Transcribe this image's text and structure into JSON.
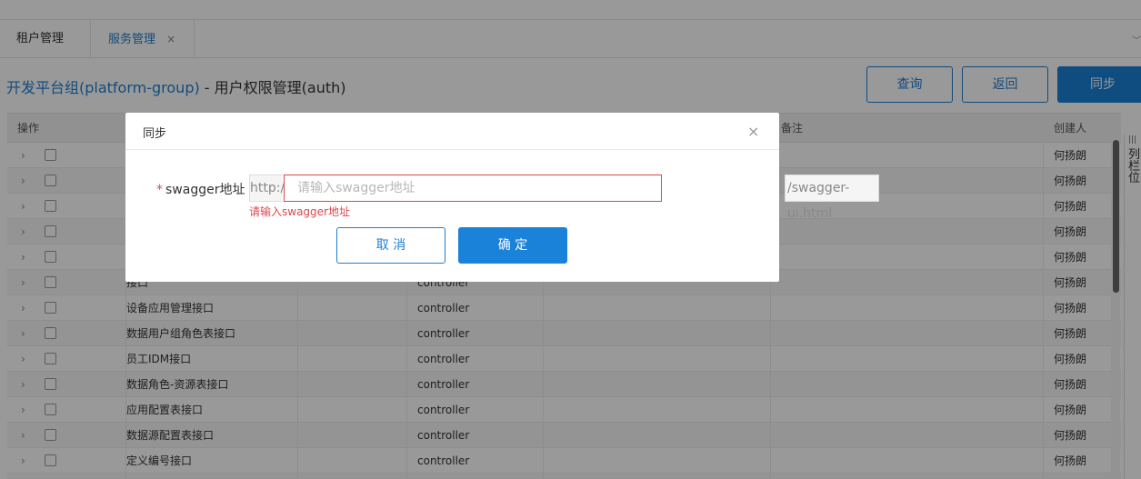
{
  "tabs": [
    {
      "label": "租户管理"
    },
    {
      "label": "服务管理",
      "close": "×"
    }
  ],
  "header": {
    "crumb_link": "开发平台组(platform-group)",
    "crumb_sep": " - ",
    "crumb_current": "用户权限管理(auth)",
    "btn_query": "查询",
    "btn_back": "返回",
    "btn_sync": "同步"
  },
  "table": {
    "headers": {
      "op": "操作",
      "remark": "备注",
      "creator": "创建人"
    },
    "rows": [
      {
        "name": "",
        "type": "",
        "creator": "何扬朗"
      },
      {
        "name": "",
        "type": "",
        "creator": "何扬朗"
      },
      {
        "name": "",
        "type": "",
        "creator": "何扬朗"
      },
      {
        "name": "",
        "type": "",
        "creator": "何扬朗"
      },
      {
        "name": "",
        "type": "",
        "creator": "何扬朗"
      },
      {
        "name": "接口",
        "type": "controller",
        "creator": "何扬朗"
      },
      {
        "name": "设备应用管理接口",
        "type": "controller",
        "creator": "何扬朗"
      },
      {
        "name": "数据用户组角色表接口",
        "type": "controller",
        "creator": "何扬朗"
      },
      {
        "name": "员工IDM接口",
        "type": "controller",
        "creator": "何扬朗"
      },
      {
        "name": "数据角色-资源表接口",
        "type": "controller",
        "creator": "何扬朗"
      },
      {
        "name": "应用配置表接口",
        "type": "controller",
        "creator": "何扬朗"
      },
      {
        "name": "数据源配置表接口",
        "type": "controller",
        "creator": "何扬朗"
      },
      {
        "name": "定义编号接口",
        "type": "controller",
        "creator": "何扬朗"
      },
      {
        "name": "",
        "type": "",
        "creator": ""
      }
    ]
  },
  "side_panel": {
    "grip": "|||",
    "chars": [
      "列",
      "栏",
      "位"
    ]
  },
  "dialog": {
    "title": "同步",
    "close": "×",
    "label_star": "*",
    "label": "swagger地址",
    "prefix": "http://",
    "placeholder": "请输入swagger地址",
    "value": "",
    "suffix": "/swagger-ui.html",
    "error": "请输入swagger地址",
    "cancel": "取 消",
    "ok": "确 定"
  },
  "colors": {
    "primary": "#1a7fd4",
    "error": "#e0464d",
    "overlay": "rgba(0,0,0,0.4)"
  }
}
